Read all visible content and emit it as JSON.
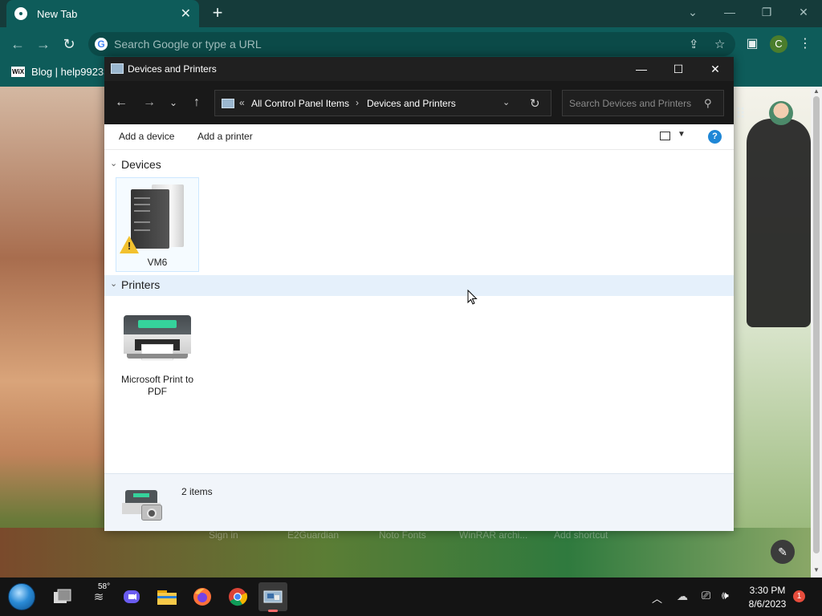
{
  "browser": {
    "tab_title": "New Tab",
    "omnibox_placeholder": "Search Google or type a URL",
    "profile_initial": "C",
    "bookmark_label": "Blog | help99233",
    "bookmark_badge": "WiX"
  },
  "page": {
    "shortcuts": [
      "Sign in",
      "E2Guardian",
      "Noto Fonts",
      "WinRAR archi...",
      "Add shortcut"
    ]
  },
  "explorer": {
    "title": "Devices and Printers",
    "breadcrumb": [
      "All Control Panel Items",
      "Devices and Printers"
    ],
    "breadcrumb_overflow": "«",
    "search_placeholder": "Search Devices and Printers",
    "commands": [
      "Add a device",
      "Add a printer"
    ],
    "help_label": "?",
    "groups": [
      {
        "label": "Devices",
        "items": [
          {
            "name": "VM6",
            "icon": "server-warning-icon",
            "status": "warning"
          }
        ]
      },
      {
        "label": "Printers",
        "items": [
          {
            "name": "Microsoft Print to PDF",
            "icon": "printer-icon"
          }
        ]
      }
    ],
    "status_text": "2 items"
  },
  "taskbar": {
    "weather_temp": "58°",
    "time": "3:30 PM",
    "date": "8/6/2023",
    "notification_count": "1"
  },
  "colors": {
    "chrome_tab": "#0e5c5a",
    "explorer_titlebar": "#202020",
    "help_blue": "#1f87d6",
    "selection": "#e5f0fb"
  }
}
